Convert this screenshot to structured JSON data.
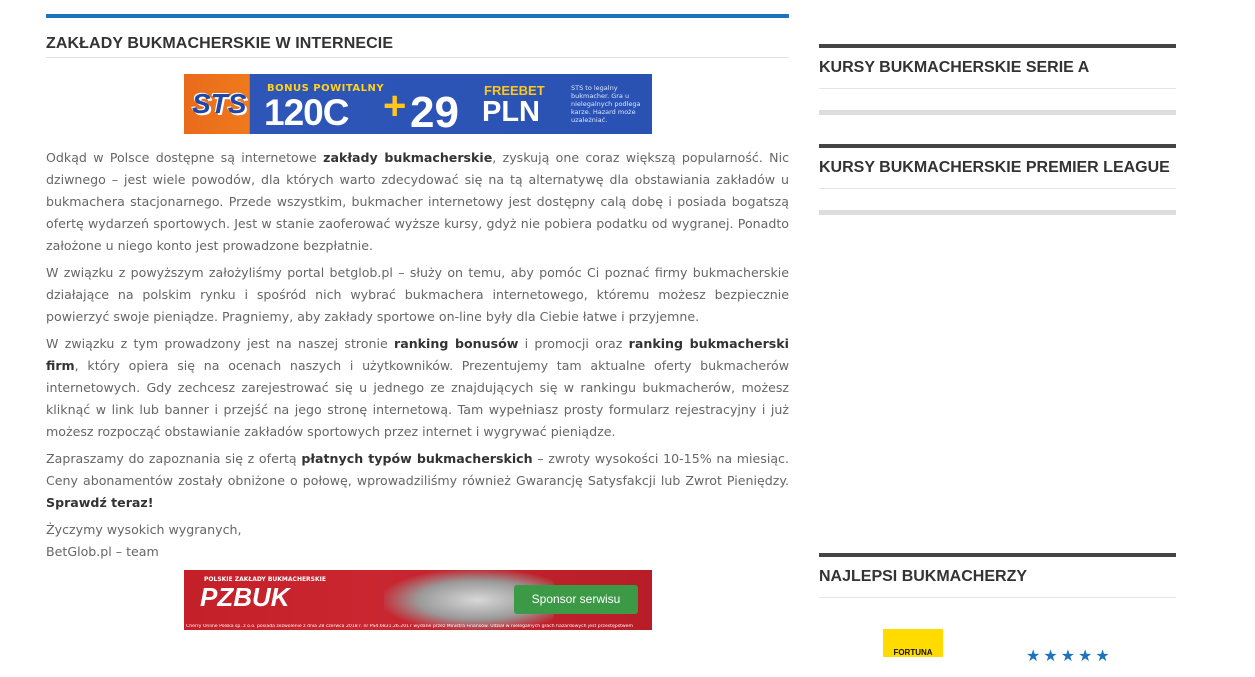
{
  "main": {
    "title": "ZAKŁADY BUKMACHERSKIE W INTERNECIE",
    "banner_top": {
      "logo": "STS",
      "bonus_label": "BONUS POWITALNY",
      "amount": "120C",
      "plus": "+",
      "freebet_amount": "29",
      "freebet_label": "FREEBET",
      "currency": "PLN",
      "disclaimer": "STS to legalny bukmacher. Gra u nielegalnych podlega karze. Hazard może uzależniać."
    },
    "paragraphs": {
      "p1_a": "Odkąd w Polsce dostępne są internetowe ",
      "p1_b": "zakłady bukmacherskie",
      "p1_c": ", zyskują one coraz większą popularność. Nic dziwnego – jest wiele powodów, dla których warto zdecydować się na tą alternatywę dla obstawiania zakładów u bukmachera stacjonarnego. Przede wszystkim, bukmacher internetowy jest dostępny calą dobę i posiada bogatszą ofertę wydarzeń sportowych. Jest w stanie zaoferować wyższe kursy, gdyż nie pobiera podatku od wygranej. Ponadto założone u niego konto jest prowadzone bezpłatnie.",
      "p2": "W związku z powyższym założyliśmy portal betglob.pl – służy on temu, aby pomóc Ci poznać firmy bukmacherskie działające na polskim rynku i spośród nich wybrać bukmachera internetowego, któremu możesz bezpiecznie powierzyć swoje pieniądze. Pragniemy, aby zakłady sportowe on-line były dla Ciebie łatwe i przyjemne.",
      "p3_a": "W związku z tym prowadzony jest na naszej stronie ",
      "p3_b": "ranking bonusów",
      "p3_c": " i promocji oraz ",
      "p3_d": "ranking bukmacherski firm",
      "p3_e": ", który opiera się na ocenach naszych i użytkowników. Prezentujemy tam aktualne oferty bukmacherów internetowych. Gdy zechcesz zarejestrować się u jednego ze znajdujących się w rankingu bukmacherów, możesz kliknąć w link lub banner i przejść na jego stronę internetową. Tam wypełniasz prosty formularz rejestracyjny i już możesz rozpocząć obstawianie zakładów sportowych przez internet i wygrywać pieniądze.",
      "p4_a": "Zapraszamy do zapoznania się z ofertą ",
      "p4_b": "płatnych typów bukmacherskich",
      "p4_c": " – zwroty wysokości 10-15% na miesiąc. Ceny abonamentów zostały obniżone o połowę, wprowadziliśmy również Gwarancję Satysfakcji lub Zwrot Pieniędzy. ",
      "p4_d": "Sprawdź teraz!",
      "p5_line1": "Życzymy wysokich wygranych,",
      "p5_line2": "BetGlob.pl – team"
    },
    "banner_bottom": {
      "tagline": "POLSKIE ZAKŁADY BUKMACHERSKIE",
      "logo": "PZBUK",
      "button": "Sponsor serwisu",
      "legal": "Cherry Online Polska sp. z o.o. posiada zezwolenie z dnia 28 czerwca 2018 r. nr PS4.6831.26.2017 wydane przez Ministra Finansów. Udział w nielegalnych grach hazardowych jest przestępstwem"
    }
  },
  "sidebar": {
    "widgets": [
      {
        "title": "KURSY BUKMACHERSKIE SERIE A"
      },
      {
        "title": "KURSY BUKMACHERSKIE PREMIER LEAGUE"
      },
      {
        "title": "NAJLEPSI BUKMACHERZY"
      }
    ],
    "bookmaker_logo": "FORTUNA",
    "rating_stars": "★★★★★"
  },
  "colors": {
    "accent": "#1e73be",
    "widget_bar": "#444444",
    "heading": "#333333",
    "body_text": "#666666"
  }
}
